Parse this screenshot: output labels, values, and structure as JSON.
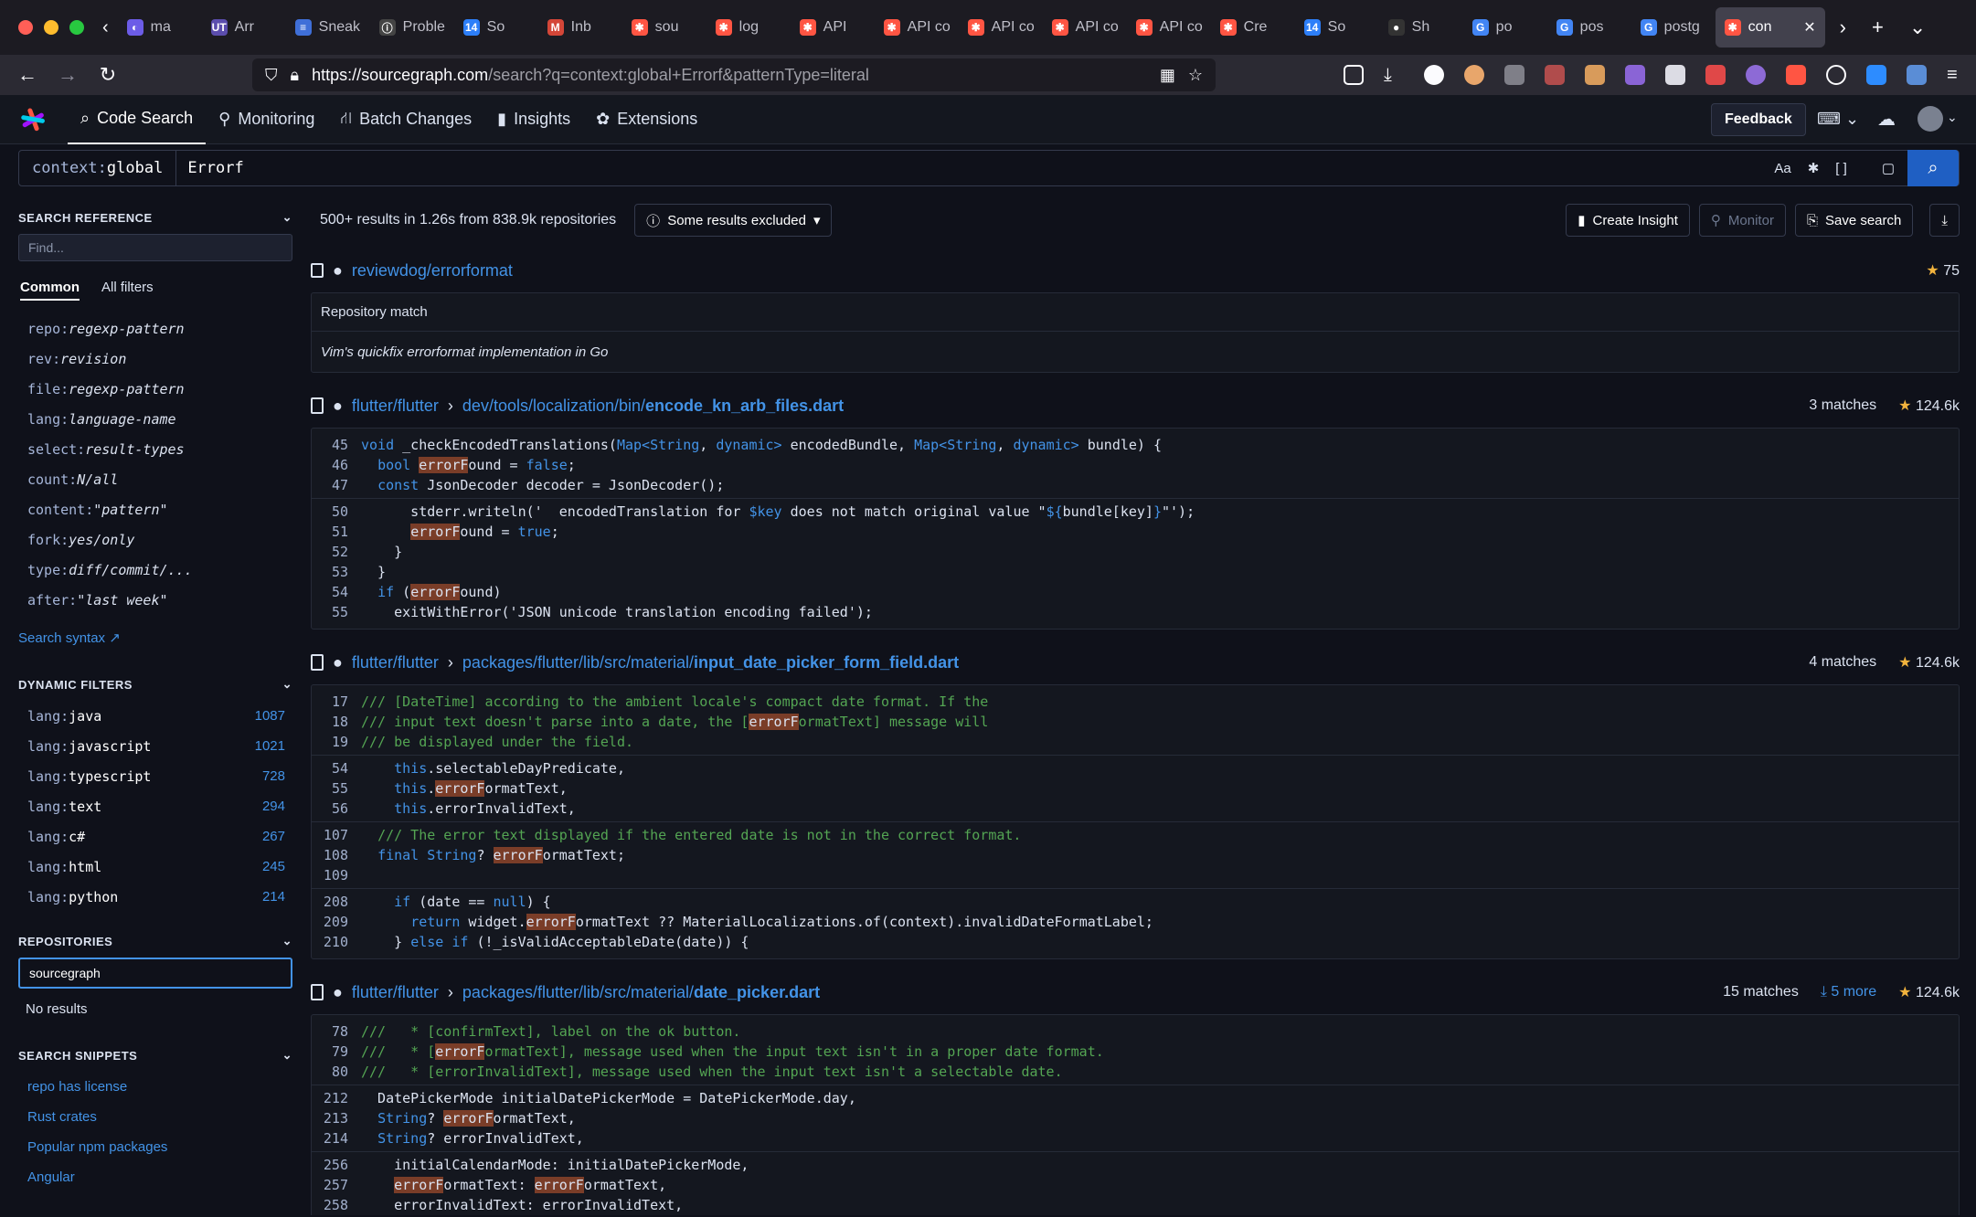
{
  "browser": {
    "tabs": [
      {
        "label": "ma",
        "color": "#6c5ce7",
        "glyph": "◐"
      },
      {
        "label": "Arr",
        "color": "#5b4dad",
        "glyph": "UT"
      },
      {
        "label": "Sneak",
        "color": "#3f6fd8",
        "glyph": "≡"
      },
      {
        "label": "Proble",
        "color": "#444",
        "glyph": "ⓘ"
      },
      {
        "label": "So",
        "color": "#2d7ff9",
        "glyph": "14"
      },
      {
        "label": "Inb",
        "color": "#d44638",
        "glyph": "M"
      },
      {
        "label": "sou",
        "color": "#ff5543",
        "glyph": "✱"
      },
      {
        "label": "log",
        "color": "#ff5543",
        "glyph": "✱"
      },
      {
        "label": "API",
        "color": "#ff5543",
        "glyph": "✱"
      },
      {
        "label": "API co",
        "color": "#ff5543",
        "glyph": "✱"
      },
      {
        "label": "API co",
        "color": "#ff5543",
        "glyph": "✱"
      },
      {
        "label": "API co",
        "color": "#ff5543",
        "glyph": "✱"
      },
      {
        "label": "API co",
        "color": "#ff5543",
        "glyph": "✱"
      },
      {
        "label": "Cre",
        "color": "#ff5543",
        "glyph": "✱"
      },
      {
        "label": "So",
        "color": "#2d7ff9",
        "glyph": "14"
      },
      {
        "label": "Sh",
        "color": "#333",
        "glyph": "●"
      },
      {
        "label": "po",
        "color": "#4285f4",
        "glyph": "G"
      },
      {
        "label": "pos",
        "color": "#4285f4",
        "glyph": "G"
      },
      {
        "label": "postg",
        "color": "#4285f4",
        "glyph": "G"
      }
    ],
    "active_tab": {
      "label": "con",
      "color": "#ff5543",
      "glyph": "✱"
    },
    "url_host": "https://sourcegraph.com",
    "url_path": "/search?q=context:global+Errorf&patternType=literal"
  },
  "appnav": {
    "items": [
      {
        "label": "Code Search",
        "icon": "⌕"
      },
      {
        "label": "Monitoring",
        "icon": "⚲"
      },
      {
        "label": "Batch Changes",
        "icon": "⛙"
      },
      {
        "label": "Insights",
        "icon": "▮"
      },
      {
        "label": "Extensions",
        "icon": "✿"
      }
    ],
    "feedback": "Feedback"
  },
  "search": {
    "context_key": "context:",
    "context_value": "global",
    "query": "Errorf"
  },
  "sidebar": {
    "reference_title": "SEARCH REFERENCE",
    "find_placeholder": "Find...",
    "tab_common": "Common",
    "tab_all": "All filters",
    "refs": [
      {
        "key": "repo:",
        "val": "regexp-pattern"
      },
      {
        "key": "rev:",
        "val": "revision"
      },
      {
        "key": "file:",
        "val": "regexp-pattern"
      },
      {
        "key": "lang:",
        "val": "language-name"
      },
      {
        "key": "select:",
        "val": "result-types"
      },
      {
        "key": "count:",
        "val": "N/all"
      },
      {
        "key": "content:",
        "val": "\"pattern\""
      },
      {
        "key": "fork:",
        "val": "yes/only"
      },
      {
        "key": "type:",
        "val": "diff/commit/..."
      },
      {
        "key": "after:",
        "val": "\"last week\""
      }
    ],
    "syntax_link": "Search syntax",
    "dynamic_title": "DYNAMIC FILTERS",
    "dynamic": [
      {
        "key": "lang:",
        "val": "java",
        "count": "1087"
      },
      {
        "key": "lang:",
        "val": "javascript",
        "count": "1021"
      },
      {
        "key": "lang:",
        "val": "typescript",
        "count": "728"
      },
      {
        "key": "lang:",
        "val": "text",
        "count": "294"
      },
      {
        "key": "lang:",
        "val": "c#",
        "count": "267"
      },
      {
        "key": "lang:",
        "val": "html",
        "count": "245"
      },
      {
        "key": "lang:",
        "val": "python",
        "count": "214"
      }
    ],
    "repos_title": "REPOSITORIES",
    "repo_input": "sourcegraph",
    "no_results": "No results",
    "snippets_title": "SEARCH SNIPPETS",
    "snippets": [
      "repo has license",
      "Rust crates",
      "Popular npm packages",
      "Angular"
    ]
  },
  "results": {
    "summary": "500+ results in 1.26s from 838.9k repositories",
    "excluded": "Some results excluded",
    "create_insight": "Create Insight",
    "monitor": "Monitor",
    "save_search": "Save search",
    "repo_match": {
      "repo": "reviewdog/errorformat",
      "stars": "75",
      "label": "Repository match",
      "description": "Vim's quickfix errorformat implementation in Go"
    },
    "files": [
      {
        "repo": "flutter/flutter",
        "dir": "dev/tools/localization/bin/",
        "file": "encode_kn_arb_files.dart",
        "matches": "3 matches",
        "more": "",
        "stars": "124.6k",
        "chunks": [
          [
            {
              "n": "45",
              "parts": [
                [
                  "kw",
                  "void "
                ],
                [
                  "tx",
                  "_checkEncodedTranslations("
                ],
                [
                  "ty",
                  "Map<String"
                ],
                [
                  "tx",
                  ", "
                ],
                [
                  "ty",
                  "dynamic>"
                ],
                [
                  "tx",
                  " encodedBundle, "
                ],
                [
                  "ty",
                  "Map<String"
                ],
                [
                  "tx",
                  ", "
                ],
                [
                  "ty",
                  "dynamic>"
                ],
                [
                  "tx",
                  " bundle) {"
                ]
              ]
            },
            {
              "n": "46",
              "parts": [
                [
                  "tx",
                  "  "
                ],
                [
                  "kw",
                  "bool "
                ],
                [
                  "hl",
                  "errorF"
                ],
                [
                  "tx",
                  "ound = "
                ],
                [
                  "kw",
                  "false"
                ],
                [
                  "tx",
                  ";"
                ]
              ]
            },
            {
              "n": "47",
              "parts": [
                [
                  "tx",
                  "  "
                ],
                [
                  "kw",
                  "const "
                ],
                [
                  "tx",
                  "JsonDecoder decoder = JsonDecoder();"
                ]
              ]
            }
          ],
          [
            {
              "n": "50",
              "parts": [
                [
                  "tx",
                  "      stderr.writeln('  encodedTranslation for "
                ],
                [
                  "kw",
                  "$key"
                ],
                [
                  "tx",
                  " does not match original value \""
                ],
                [
                  "kw",
                  "${"
                ],
                [
                  "tx",
                  "bundle[key]"
                ],
                [
                  "kw",
                  "}"
                ],
                [
                  "tx",
                  "\"');"
                ]
              ]
            },
            {
              "n": "51",
              "parts": [
                [
                  "tx",
                  "      "
                ],
                [
                  "hl",
                  "errorF"
                ],
                [
                  "tx",
                  "ound = "
                ],
                [
                  "kw",
                  "true"
                ],
                [
                  "tx",
                  ";"
                ]
              ]
            },
            {
              "n": "52",
              "parts": [
                [
                  "tx",
                  "    }"
                ]
              ]
            },
            {
              "n": "53",
              "parts": [
                [
                  "tx",
                  "  }"
                ]
              ]
            },
            {
              "n": "54",
              "parts": [
                [
                  "tx",
                  "  "
                ],
                [
                  "kw",
                  "if "
                ],
                [
                  "tx",
                  "("
                ],
                [
                  "hl",
                  "errorF"
                ],
                [
                  "tx",
                  "ound)"
                ]
              ]
            },
            {
              "n": "55",
              "parts": [
                [
                  "tx",
                  "    exitWithError('JSON unicode translation encoding failed');"
                ]
              ]
            }
          ]
        ]
      },
      {
        "repo": "flutter/flutter",
        "dir": "packages/flutter/lib/src/material/",
        "file": "input_date_picker_form_field.dart",
        "matches": "4 matches",
        "more": "",
        "stars": "124.6k",
        "chunks": [
          [
            {
              "n": "17",
              "parts": [
                [
                  "cm",
                  "/// [DateTime] according to the ambient locale's compact date format. If the"
                ]
              ]
            },
            {
              "n": "18",
              "parts": [
                [
                  "cm",
                  "/// input text doesn't parse into a date, the ["
                ],
                [
                  "hl",
                  "errorF"
                ],
                [
                  "cm",
                  "ormatText] message will"
                ]
              ]
            },
            {
              "n": "19",
              "parts": [
                [
                  "cm",
                  "/// be displayed under the field."
                ]
              ]
            }
          ],
          [
            {
              "n": "54",
              "parts": [
                [
                  "tx",
                  "    "
                ],
                [
                  "kw",
                  "this"
                ],
                [
                  "tx",
                  ".selectableDayPredicate,"
                ]
              ]
            },
            {
              "n": "55",
              "parts": [
                [
                  "tx",
                  "    "
                ],
                [
                  "kw",
                  "this"
                ],
                [
                  "tx",
                  "."
                ],
                [
                  "hl",
                  "errorF"
                ],
                [
                  "tx",
                  "ormatText,"
                ]
              ]
            },
            {
              "n": "56",
              "parts": [
                [
                  "tx",
                  "    "
                ],
                [
                  "kw",
                  "this"
                ],
                [
                  "tx",
                  ".errorInvalidText,"
                ]
              ]
            }
          ],
          [
            {
              "n": "107",
              "parts": [
                [
                  "tx",
                  "  "
                ],
                [
                  "cm",
                  "/// The error text displayed if the entered date is not in the correct format."
                ]
              ]
            },
            {
              "n": "108",
              "parts": [
                [
                  "tx",
                  "  "
                ],
                [
                  "kw",
                  "final "
                ],
                [
                  "ty",
                  "String"
                ],
                [
                  "tx",
                  "? "
                ],
                [
                  "hl",
                  "errorF"
                ],
                [
                  "tx",
                  "ormatText;"
                ]
              ]
            },
            {
              "n": "109",
              "parts": [
                [
                  "tx",
                  ""
                ]
              ]
            }
          ],
          [
            {
              "n": "208",
              "parts": [
                [
                  "tx",
                  "    "
                ],
                [
                  "kw",
                  "if "
                ],
                [
                  "tx",
                  "(date == "
                ],
                [
                  "kw",
                  "null"
                ],
                [
                  "tx",
                  ") {"
                ]
              ]
            },
            {
              "n": "209",
              "parts": [
                [
                  "tx",
                  "      "
                ],
                [
                  "kw",
                  "return "
                ],
                [
                  "tx",
                  "widget."
                ],
                [
                  "hl",
                  "errorF"
                ],
                [
                  "tx",
                  "ormatText ?? MaterialLocalizations.of(context).invalidDateFormatLabel;"
                ]
              ]
            },
            {
              "n": "210",
              "parts": [
                [
                  "tx",
                  "    } "
                ],
                [
                  "kw",
                  "else if "
                ],
                [
                  "tx",
                  "(!_isValidAcceptableDate(date)) {"
                ]
              ]
            }
          ]
        ]
      },
      {
        "repo": "flutter/flutter",
        "dir": "packages/flutter/lib/src/material/",
        "file": "date_picker.dart",
        "matches": "15 matches",
        "more": "5 more",
        "stars": "124.6k",
        "chunks": [
          [
            {
              "n": "78",
              "parts": [
                [
                  "cm",
                  "///   * [confirmText], label on the ok button."
                ]
              ]
            },
            {
              "n": "79",
              "parts": [
                [
                  "cm",
                  "///   * ["
                ],
                [
                  "hl",
                  "errorF"
                ],
                [
                  "cm",
                  "ormatText], message used when the input text isn't in a proper date format."
                ]
              ]
            },
            {
              "n": "80",
              "parts": [
                [
                  "cm",
                  "///   * [errorInvalidText], message used when the input text isn't a selectable date."
                ]
              ]
            }
          ],
          [
            {
              "n": "212",
              "parts": [
                [
                  "tx",
                  "  DatePickerMode initialDatePickerMode = DatePickerMode.day,"
                ]
              ]
            },
            {
              "n": "213",
              "parts": [
                [
                  "tx",
                  "  "
                ],
                [
                  "ty",
                  "String"
                ],
                [
                  "tx",
                  "? "
                ],
                [
                  "hl",
                  "errorF"
                ],
                [
                  "tx",
                  "ormatText,"
                ]
              ]
            },
            {
              "n": "214",
              "parts": [
                [
                  "tx",
                  "  "
                ],
                [
                  "ty",
                  "String"
                ],
                [
                  "tx",
                  "? errorInvalidText,"
                ]
              ]
            }
          ],
          [
            {
              "n": "256",
              "parts": [
                [
                  "tx",
                  "    initialCalendarMode: initialDatePickerMode,"
                ]
              ]
            },
            {
              "n": "257",
              "parts": [
                [
                  "tx",
                  "    "
                ],
                [
                  "hl",
                  "errorF"
                ],
                [
                  "tx",
                  "ormatText: "
                ],
                [
                  "hl",
                  "errorF"
                ],
                [
                  "tx",
                  "ormatText,"
                ]
              ]
            },
            {
              "n": "258",
              "parts": [
                [
                  "tx",
                  "    errorInvalidText: errorInvalidText,"
                ]
              ]
            }
          ]
        ]
      }
    ]
  }
}
